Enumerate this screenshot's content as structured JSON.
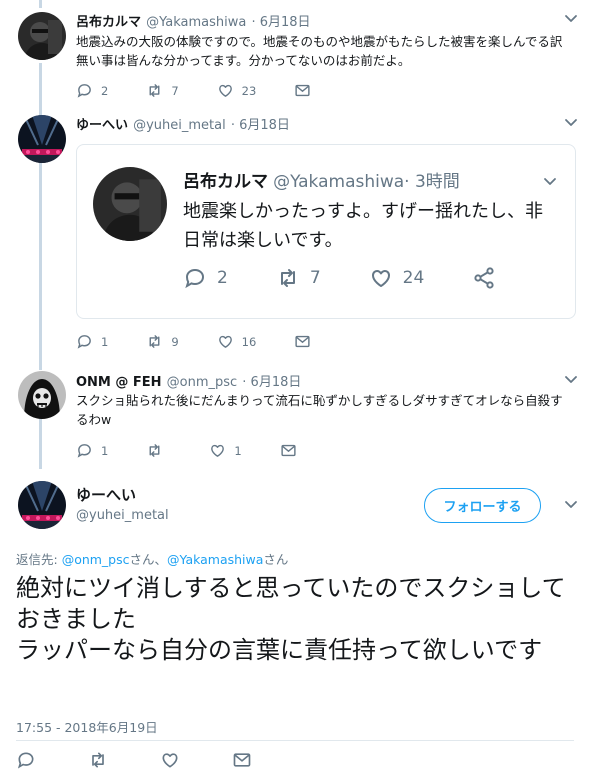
{
  "tweets": [
    {
      "name": "呂布カルマ",
      "handle": "@Yakamashiwa",
      "time": "· 6月18日",
      "text": "地震込みの大阪の体験ですので。地震そのものや地震がもたらした被害を楽しんでる訳無い事は皆んな分かってます。分かってないのはお前だよ。",
      "replies": "2",
      "retweets": "7",
      "likes": "23"
    },
    {
      "name": "ゆーへい",
      "handle": "@yuhei_metal",
      "time": "· 6月18日",
      "replies": "1",
      "retweets": "9",
      "likes": "16"
    },
    {
      "name": "ONM @ FEH",
      "handle": "@onm_psc",
      "time": "· 6月18日",
      "text": "スクショ貼られた後にだんまりって流石に恥ずかしすぎるしダサすぎてオレなら自殺するわw",
      "replies": "1",
      "retweets": "",
      "likes": "1"
    }
  ],
  "quote": {
    "name": "呂布カルマ",
    "handle": "@Yakamashiwa",
    "time": "· 3時間",
    "text": "地震楽しかったっすよ。すげー揺れたし、非日常は楽しいです。",
    "replies": "2",
    "retweets": "7",
    "likes": "24"
  },
  "main_tweet": {
    "name": "ゆーへい",
    "handle": "@yuhei_metal",
    "follow_label": "フォローする",
    "reply_prefix": "返信先: ",
    "mention1": "@onm_psc",
    "sep1": "さん、",
    "mention2": "@Yakamashiwa",
    "sep2": "さん",
    "text": "絶対にツイ消しすると思っていたのでスクショしておきました\nラッパーなら自分の言葉に責任持って欲しいです",
    "timestamp": "17:55 - 2018年6月19日"
  },
  "colors": {
    "accent": "#1da1f2",
    "muted": "#657786",
    "thread": "#c8d7e4"
  },
  "icons": [
    "reply-icon",
    "retweet-icon",
    "like-icon",
    "dm-icon",
    "share-icon",
    "chevron-down-icon"
  ]
}
